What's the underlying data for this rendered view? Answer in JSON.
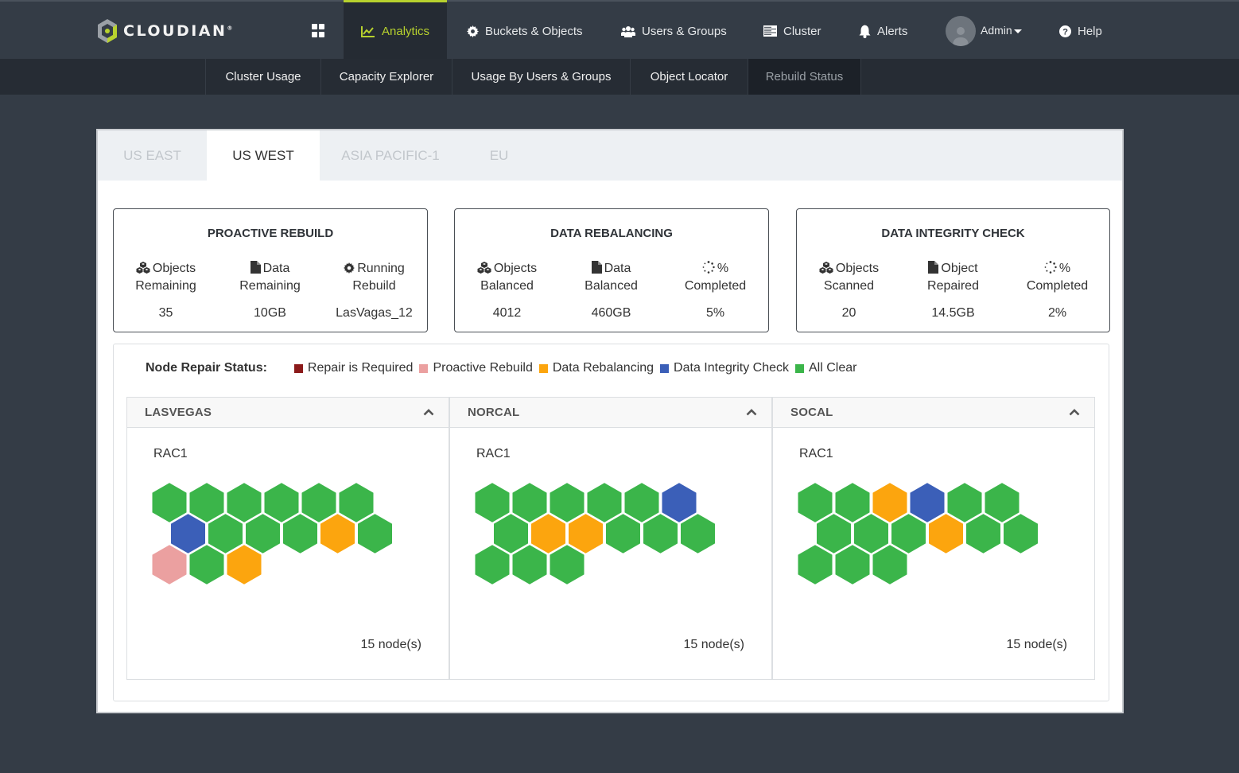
{
  "brand": {
    "name": "CLOUDIAN",
    "accent": "#b7d12e"
  },
  "topnav": {
    "apps_icon": "grid-icon",
    "items": [
      {
        "label": "Analytics",
        "icon": "line-chart-icon",
        "active": true
      },
      {
        "label": "Buckets & Objects",
        "icon": "gear-icon"
      },
      {
        "label": "Users & Groups",
        "icon": "users-icon"
      },
      {
        "label": "Cluster",
        "icon": "server-icon"
      },
      {
        "label": "Alerts",
        "icon": "bell-icon"
      },
      {
        "label": "Admin",
        "icon": "avatar",
        "dropdown": true
      },
      {
        "label": "Help",
        "icon": "question-circle-icon"
      }
    ]
  },
  "subnav": {
    "items": [
      {
        "label": "Cluster Usage"
      },
      {
        "label": "Capacity Explorer"
      },
      {
        "label": "Usage By Users & Groups"
      },
      {
        "label": "Object Locator"
      },
      {
        "label": "Rebuild Status",
        "active": true
      }
    ]
  },
  "region_tabs": [
    {
      "label": "US EAST"
    },
    {
      "label": "US WEST",
      "active": true
    },
    {
      "label": "ASIA PACIFIC-1"
    },
    {
      "label": "EU"
    }
  ],
  "cards": [
    {
      "title": "PROACTIVE REBUILD",
      "metrics": [
        {
          "icon": "cubes-icon",
          "label_1": "Objects",
          "label_2": "Remaining",
          "value": "35"
        },
        {
          "icon": "file-icon",
          "label_1": "Data",
          "label_2": "Remaining",
          "value": "10GB"
        },
        {
          "icon": "gear-icon",
          "label_1": "Running",
          "label_2": "Rebuild",
          "value": "LasVagas_12"
        }
      ]
    },
    {
      "title": "DATA REBALANCING",
      "metrics": [
        {
          "icon": "cubes-icon",
          "label_1": "Objects",
          "label_2": "Balanced",
          "value": "4012"
        },
        {
          "icon": "file-icon",
          "label_1": "Data",
          "label_2": "Balanced",
          "value": "460GB"
        },
        {
          "icon": "spinner-icon",
          "label_1": "%",
          "label_2": "Completed",
          "value": "5%"
        }
      ]
    },
    {
      "title": "DATA INTEGRITY CHECK",
      "metrics": [
        {
          "icon": "cubes-icon",
          "label_1": "Objects",
          "label_2": "Scanned",
          "value": "20"
        },
        {
          "icon": "file-icon",
          "label_1": "Object",
          "label_2": "Repaired",
          "value": "14.5GB"
        },
        {
          "icon": "spinner-icon",
          "label_1": "%",
          "label_2": "Completed",
          "value": "2%"
        }
      ]
    }
  ],
  "legend": {
    "title": "Node Repair Status:",
    "items": [
      {
        "key": "repair",
        "label": "Repair is Required",
        "color": "#8b1a1a"
      },
      {
        "key": "proactive",
        "label": "Proactive Rebuild",
        "color": "#eba0a0"
      },
      {
        "key": "rebalance",
        "label": "Data Rebalancing",
        "color": "#fca50e"
      },
      {
        "key": "integrity",
        "label": "Data Integrity Check",
        "color": "#3b5fb8"
      },
      {
        "key": "clear",
        "label": "All Clear",
        "color": "#3bb54a"
      }
    ]
  },
  "sites": [
    {
      "name": "LASVEGAS",
      "rack": "RAC1",
      "node_count": "15 node(s)",
      "nodes": [
        [
          "clear",
          "clear",
          "clear",
          "clear",
          "clear",
          "clear"
        ],
        [
          "integrity",
          "clear",
          "clear",
          "clear",
          "rebalance",
          "clear"
        ],
        [
          "proactive",
          "clear",
          "rebalance"
        ]
      ]
    },
    {
      "name": "NORCAL",
      "rack": "RAC1",
      "node_count": "15 node(s)",
      "nodes": [
        [
          "clear",
          "clear",
          "clear",
          "clear",
          "clear",
          "integrity"
        ],
        [
          "clear",
          "rebalance",
          "rebalance",
          "clear",
          "clear",
          "clear"
        ],
        [
          "clear",
          "clear",
          "clear"
        ]
      ]
    },
    {
      "name": "SOCAL",
      "rack": "RAC1",
      "node_count": "15 node(s)",
      "nodes": [
        [
          "clear",
          "clear",
          "rebalance",
          "integrity",
          "clear",
          "clear"
        ],
        [
          "clear",
          "clear",
          "clear",
          "rebalance",
          "clear",
          "clear"
        ],
        [
          "clear",
          "clear",
          "clear"
        ]
      ]
    }
  ]
}
